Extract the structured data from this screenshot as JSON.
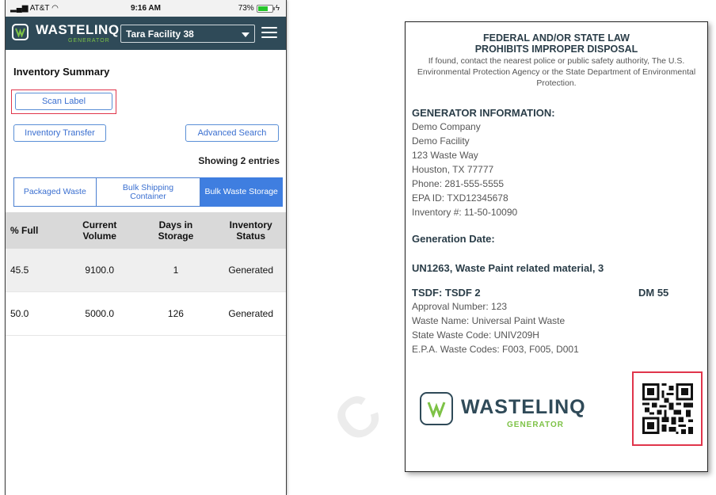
{
  "statusbar": {
    "carrier": "AT&T",
    "time": "9:16 AM",
    "battery": "73%"
  },
  "header": {
    "brand": "WASTELINQ",
    "brand_sub": "GENERATOR",
    "facility": "Tara Facility 38"
  },
  "page": {
    "title": "Inventory Summary",
    "showing": "Showing 2 entries"
  },
  "buttons": {
    "scan": "Scan Label",
    "transfer": "Inventory Transfer",
    "advanced": "Advanced Search"
  },
  "tabs": [
    {
      "label": "Packaged Waste",
      "active": false
    },
    {
      "label": "Bulk Shipping Container",
      "active": false
    },
    {
      "label": "Bulk Waste Storage",
      "active": true
    }
  ],
  "table": {
    "headers": [
      "% Full",
      "Current Volume",
      "Days in Storage",
      "Inventory Status"
    ],
    "rows": [
      [
        "45.5",
        "9100.0",
        "1",
        "Generated"
      ],
      [
        "50.0",
        "5000.0",
        "126",
        "Generated"
      ]
    ]
  },
  "label": {
    "law_line1": "FEDERAL AND/OR STATE LAW",
    "law_line2": "PROHIBITS IMPROPER DISPOSAL",
    "law_text": "If found, contact the nearest police or public safety authority, The U.S. Environmental Protection Agency or the State Department of Environmental Protection.",
    "gen_head": "GENERATOR INFORMATION:",
    "company": "Demo Company",
    "facility": "Demo Facility",
    "street": "123 Waste Way",
    "city": "Houston, TX 77777",
    "phone": "Phone: 281-555-5555",
    "epa": "EPA ID: TXD12345678",
    "inventory": "Inventory #: 11-50-10090",
    "gen_date": "Generation Date:",
    "un": "UN1263, Waste Paint related material, 3",
    "tsdf": "TSDF: TSDF 2",
    "dm": "DM 55",
    "approval": "Approval Number: 123",
    "waste_name": "Waste Name: Universal Paint Waste",
    "state_code": "State Waste Code: UNIV209H",
    "epa_codes": "E.P.A. Waste Codes: F003, F005, D001",
    "brand": "WASTELINQ",
    "brand_sub": "GENERATOR"
  },
  "colors": {
    "header_bg": "#2f4a58",
    "accent_blue": "#3f7ee0",
    "brand_green": "#7dc246",
    "highlight_red": "#e0354b"
  }
}
